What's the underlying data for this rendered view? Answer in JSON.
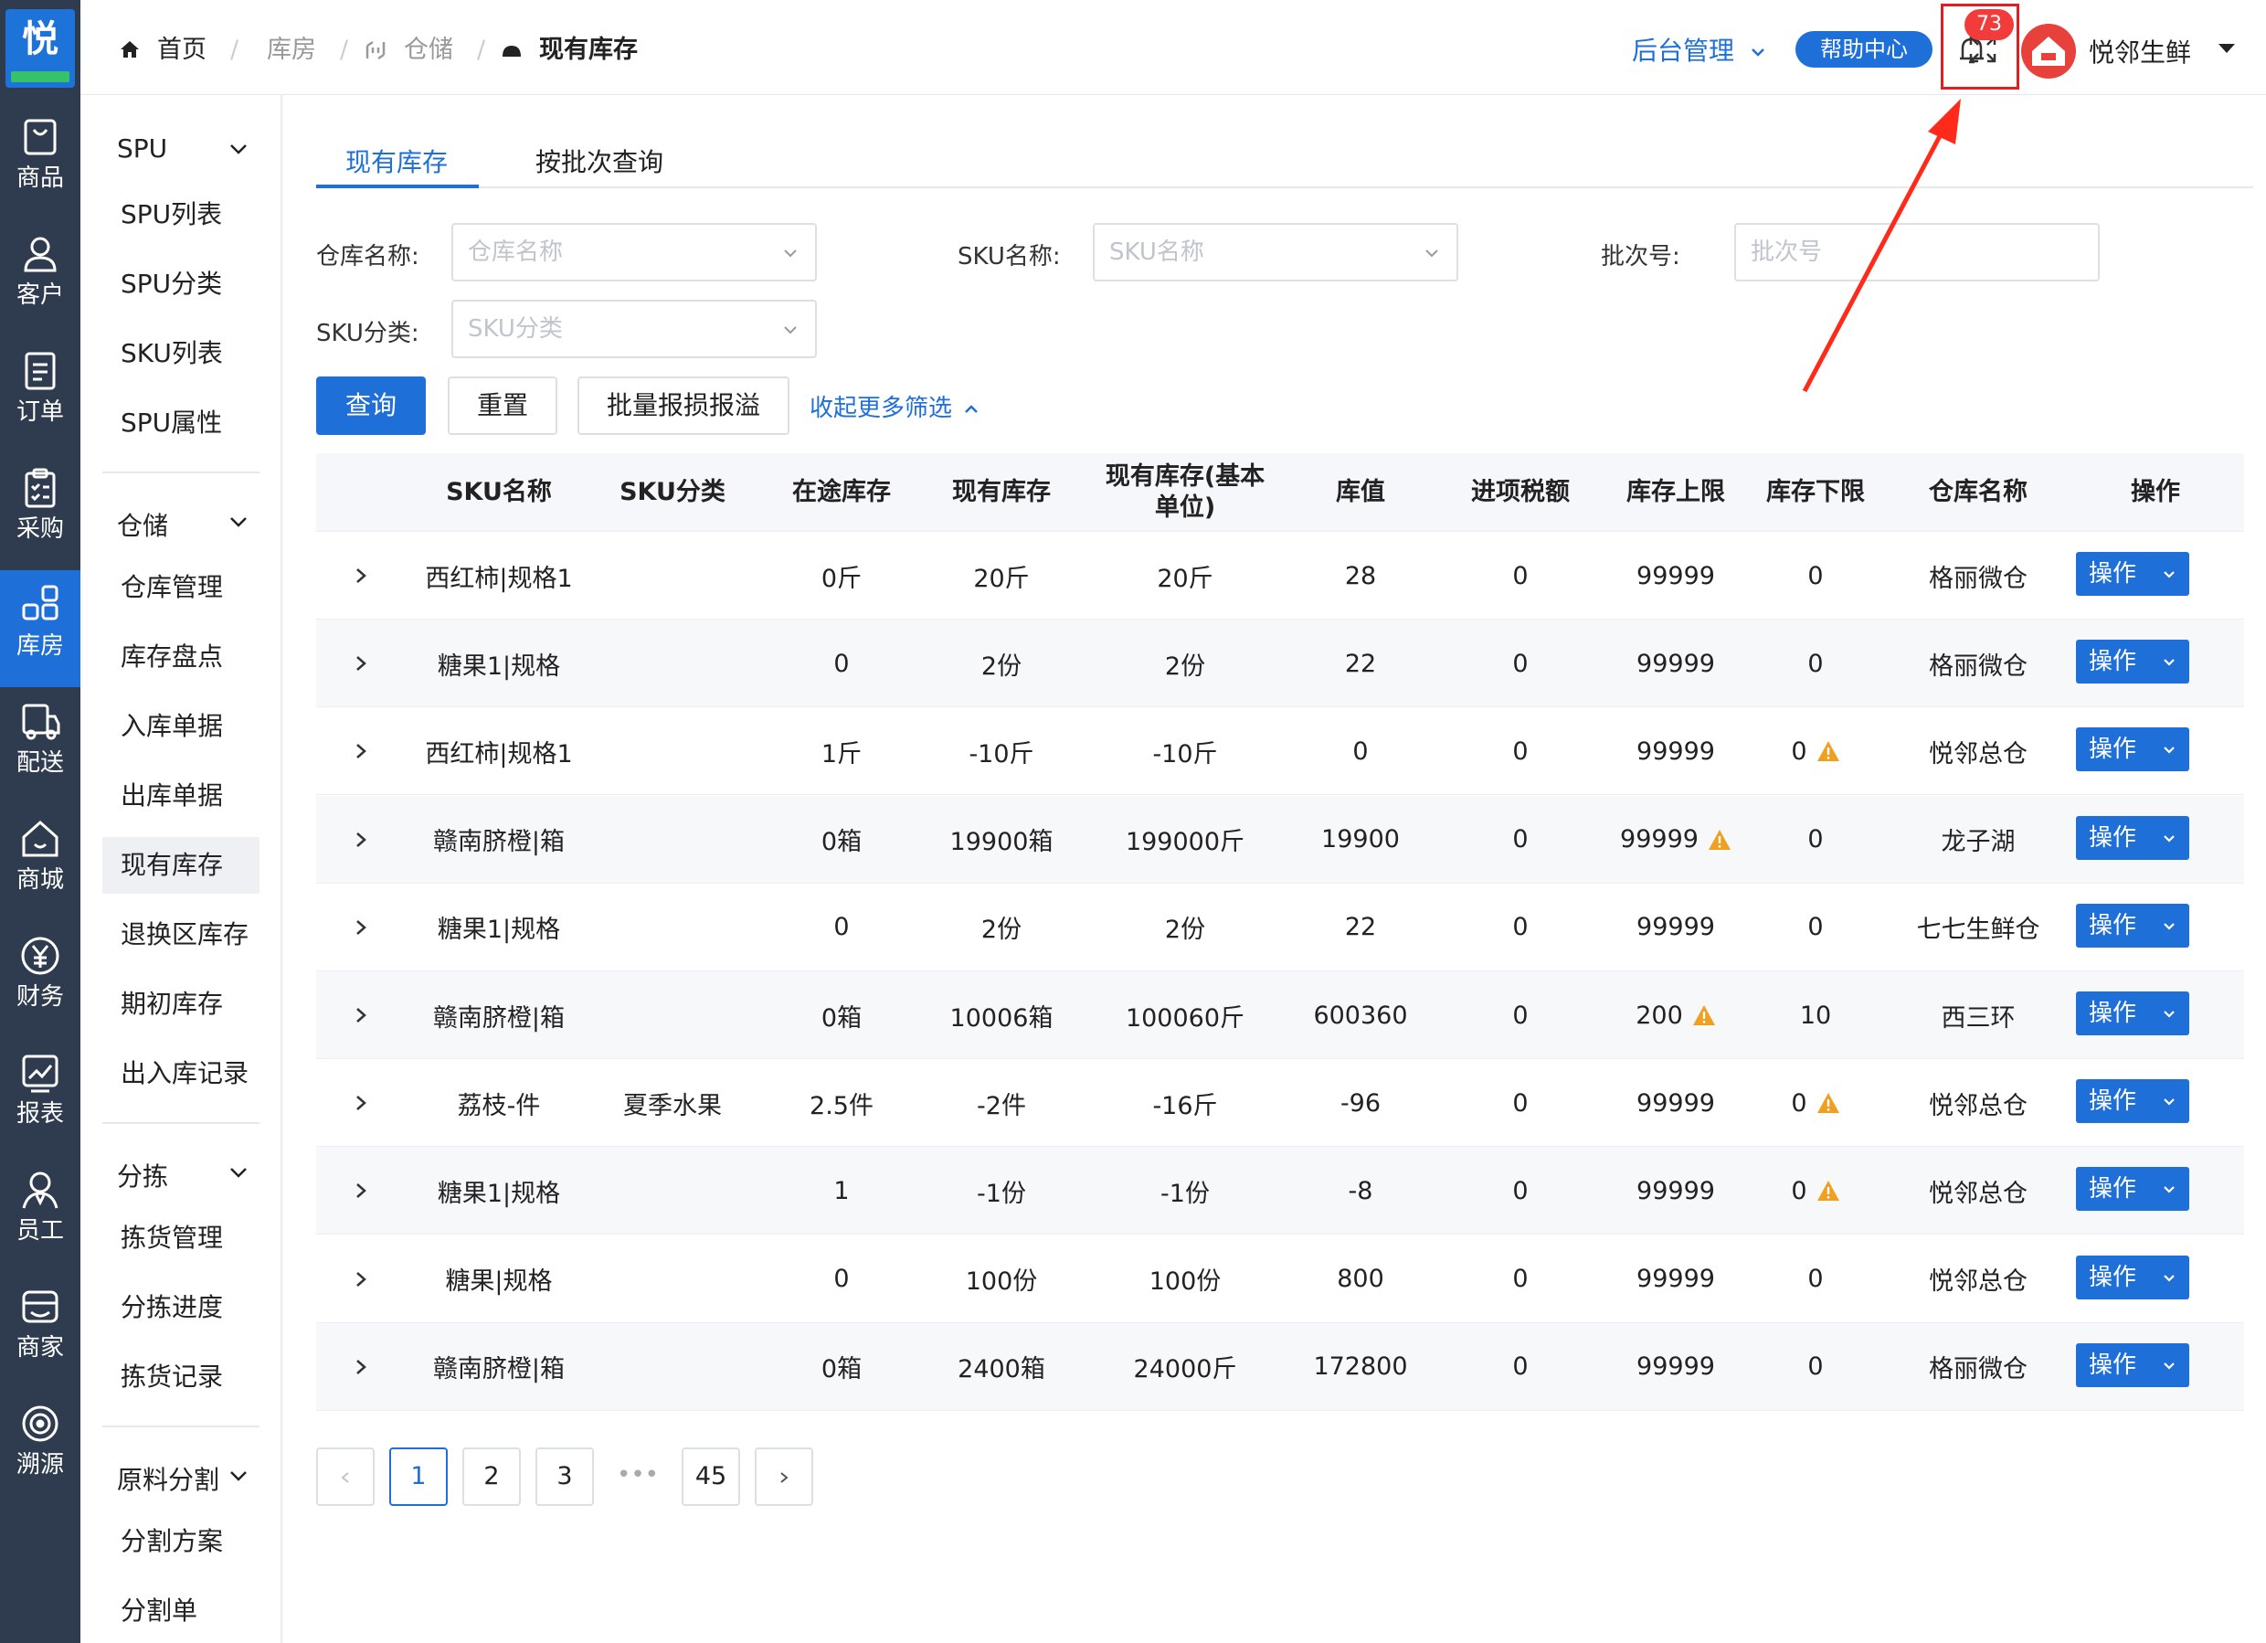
{
  "brand": {
    "logo_char": "悦"
  },
  "rail": {
    "items": [
      {
        "label": "商品",
        "icon": "bag-icon"
      },
      {
        "label": "客户",
        "icon": "user-icon"
      },
      {
        "label": "订单",
        "icon": "order-icon"
      },
      {
        "label": "采购",
        "icon": "clipboard-icon"
      },
      {
        "label": "库房",
        "icon": "grid-icon",
        "active": true
      },
      {
        "label": "配送",
        "icon": "truck-icon"
      },
      {
        "label": "商城",
        "icon": "home-icon"
      },
      {
        "label": "财务",
        "icon": "yen-icon"
      },
      {
        "label": "报表",
        "icon": "chart-icon"
      },
      {
        "label": "员工",
        "icon": "staff-icon"
      },
      {
        "label": "商家",
        "icon": "store-icon"
      },
      {
        "label": "溯源",
        "icon": "trace-icon"
      }
    ]
  },
  "breadcrumb": {
    "home": "首页",
    "level1": "库房",
    "level2": "仓储",
    "current": "现有库存"
  },
  "header": {
    "admin_label": "后台管理",
    "help_label": "帮助中心",
    "notification_count": "73",
    "user_name": "悦邻生鲜"
  },
  "subnav": {
    "groups": [
      {
        "label": "SPU",
        "items": [
          "SPU列表",
          "SPU分类",
          "SKU列表",
          "SPU属性"
        ]
      },
      {
        "label": "仓储",
        "items": [
          "仓库管理",
          "库存盘点",
          "入库单据",
          "出库单据",
          "现有库存",
          "退换区库存",
          "期初库存",
          "出入库记录"
        ]
      },
      {
        "label": "分拣",
        "items": [
          "拣货管理",
          "分拣进度",
          "拣货记录"
        ]
      },
      {
        "label": "原料分割",
        "items": [
          "分割方案",
          "分割单"
        ]
      }
    ],
    "active_item": "现有库存"
  },
  "tabs": [
    "现有库存",
    "按批次查询"
  ],
  "filters": {
    "warehouse_label": "仓库名称:",
    "warehouse_placeholder": "仓库名称",
    "sku_name_label": "SKU名称:",
    "sku_name_placeholder": "SKU名称",
    "batch_label": "批次号:",
    "batch_placeholder": "批次号",
    "sku_cat_label": "SKU分类:",
    "sku_cat_placeholder": "SKU分类"
  },
  "actions": {
    "query": "查询",
    "reset": "重置",
    "batch_loss": "批量报损报溢",
    "collapse": "收起更多筛选"
  },
  "table": {
    "columns": [
      "SKU名称",
      "SKU分类",
      "在途库存",
      "现有库存",
      "现有库存(基本单位)",
      "库值",
      "进项税额",
      "库存上限",
      "库存下限",
      "仓库名称",
      "操作"
    ],
    "op_label": "操作",
    "rows": [
      {
        "sku": "西红柿|规格1",
        "cat": "",
        "transit": "0斤",
        "stock": "20斤",
        "base": "20斤",
        "value": "28",
        "tax": "0",
        "upper": "99999",
        "upper_warn": false,
        "lower": "0",
        "lower_warn": false,
        "wh": "格丽微仓"
      },
      {
        "sku": "糖果1|规格",
        "cat": "",
        "transit": "0",
        "stock": "2份",
        "base": "2份",
        "value": "22",
        "tax": "0",
        "upper": "99999",
        "upper_warn": false,
        "lower": "0",
        "lower_warn": false,
        "wh": "格丽微仓"
      },
      {
        "sku": "西红柿|规格1",
        "cat": "",
        "transit": "1斤",
        "stock": "-10斤",
        "base": "-10斤",
        "value": "0",
        "tax": "0",
        "upper": "99999",
        "upper_warn": false,
        "lower": "0",
        "lower_warn": true,
        "wh": "悦邻总仓"
      },
      {
        "sku": "赣南脐橙|箱",
        "cat": "",
        "transit": "0箱",
        "stock": "19900箱",
        "base": "199000斤",
        "value": "19900",
        "tax": "0",
        "upper": "99999",
        "upper_warn": true,
        "lower": "0",
        "lower_warn": false,
        "wh": "龙子湖"
      },
      {
        "sku": "糖果1|规格",
        "cat": "",
        "transit": "0",
        "stock": "2份",
        "base": "2份",
        "value": "22",
        "tax": "0",
        "upper": "99999",
        "upper_warn": false,
        "lower": "0",
        "lower_warn": false,
        "wh": "七七生鲜仓"
      },
      {
        "sku": "赣南脐橙|箱",
        "cat": "",
        "transit": "0箱",
        "stock": "10006箱",
        "base": "100060斤",
        "value": "600360",
        "tax": "0",
        "upper": "200",
        "upper_warn": true,
        "lower": "10",
        "lower_warn": false,
        "wh": "西三环"
      },
      {
        "sku": "荔枝-件",
        "cat": "夏季水果",
        "transit": "2.5件",
        "stock": "-2件",
        "base": "-16斤",
        "value": "-96",
        "tax": "0",
        "upper": "99999",
        "upper_warn": false,
        "lower": "0",
        "lower_warn": true,
        "wh": "悦邻总仓"
      },
      {
        "sku": "糖果1|规格",
        "cat": "",
        "transit": "1",
        "stock": "-1份",
        "base": "-1份",
        "value": "-8",
        "tax": "0",
        "upper": "99999",
        "upper_warn": false,
        "lower": "0",
        "lower_warn": true,
        "wh": "悦邻总仓"
      },
      {
        "sku": "糖果|规格",
        "cat": "",
        "transit": "0",
        "stock": "100份",
        "base": "100份",
        "value": "800",
        "tax": "0",
        "upper": "99999",
        "upper_warn": false,
        "lower": "0",
        "lower_warn": false,
        "wh": "悦邻总仓"
      },
      {
        "sku": "赣南脐橙|箱",
        "cat": "",
        "transit": "0箱",
        "stock": "2400箱",
        "base": "24000斤",
        "value": "172800",
        "tax": "0",
        "upper": "99999",
        "upper_warn": false,
        "lower": "0",
        "lower_warn": false,
        "wh": "格丽微仓"
      }
    ]
  },
  "pagination": {
    "pages": [
      "1",
      "2",
      "3",
      "45"
    ],
    "current": "1",
    "ellipsis": "•••"
  },
  "colors": {
    "primary": "#1f6fd9",
    "rail": "#2f3c4f",
    "warn": "#f0a020",
    "highlight": "#e02020"
  }
}
